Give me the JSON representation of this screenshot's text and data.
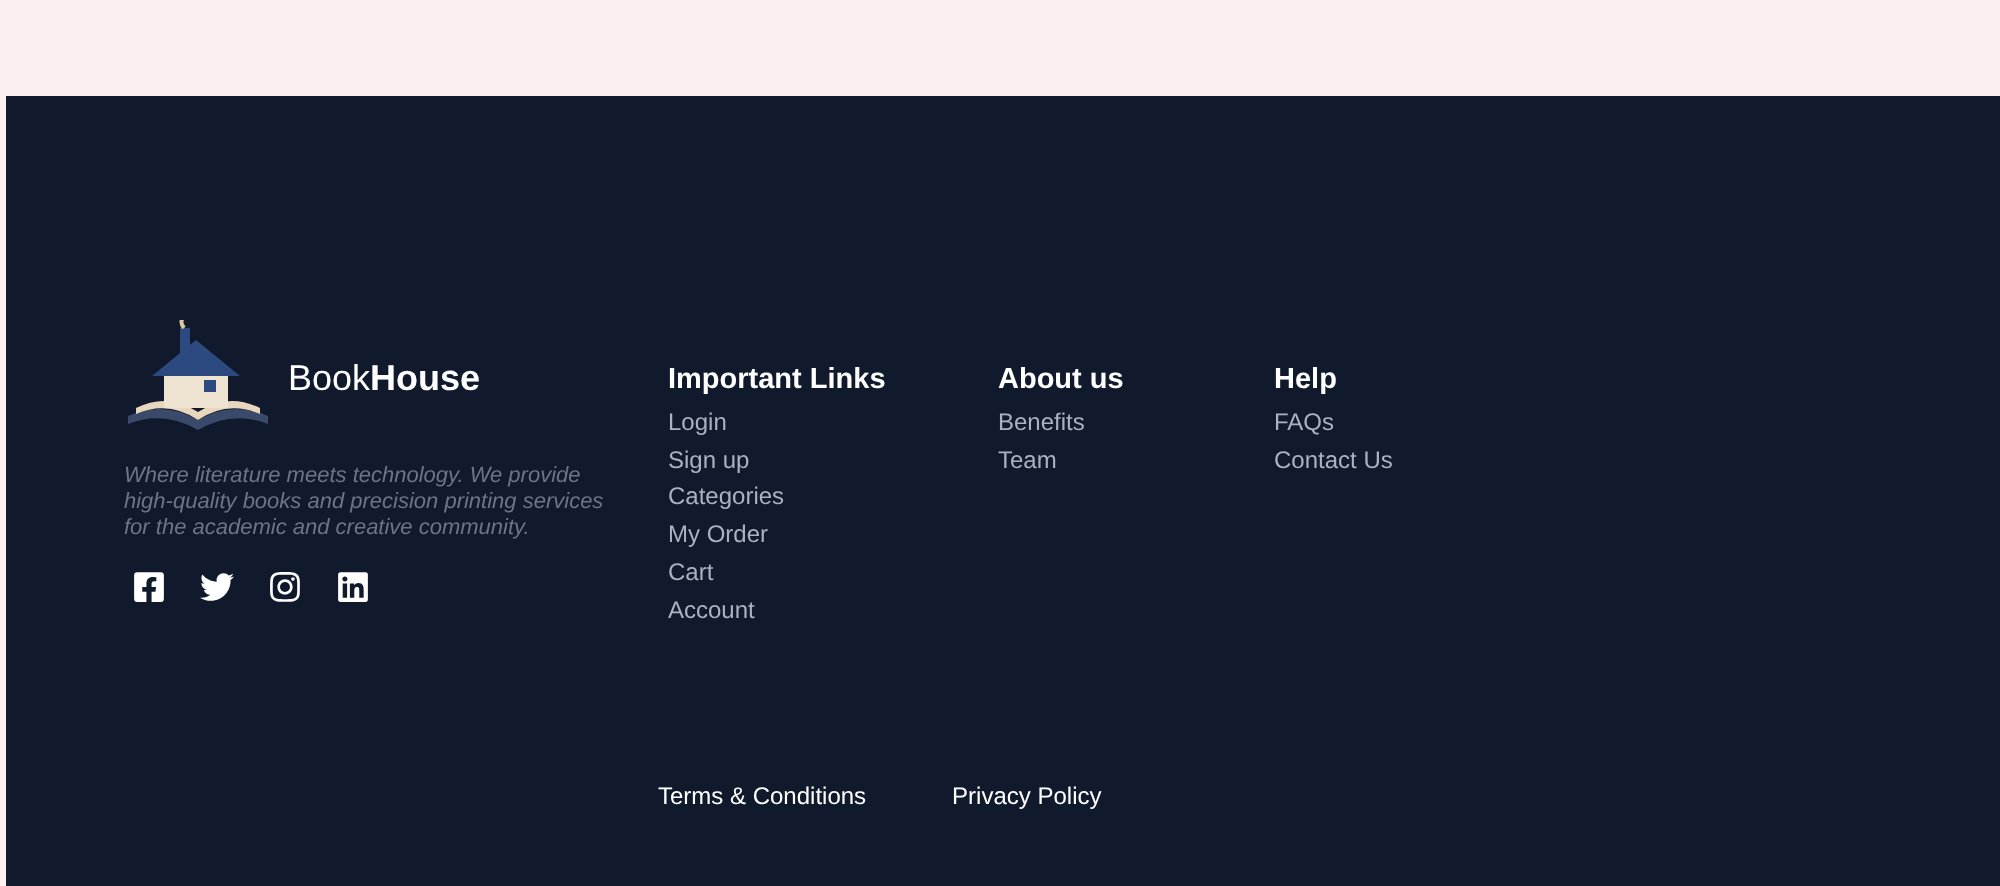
{
  "brand": {
    "name": "Book**House**",
    "tagline": "Where literature meets technology. We provide high-quality books and precision printing services for the academic and creative community."
  },
  "social": [
    {
      "kind": "facebook"
    },
    {
      "kind": "twitter"
    },
    {
      "kind": "instagram"
    },
    {
      "kind": "linkedin"
    }
  ],
  "columns": [
    {
      "title": "Important Links",
      "links": [
        "Login",
        "Sign up",
        "Categories",
        "My Order",
        "Cart",
        "Account"
      ]
    },
    {
      "title": "About us",
      "links": [
        "Benefits",
        "Team"
      ]
    },
    {
      "title": "Help",
      "links": [
        "FAQs",
        "Contact Us"
      ]
    }
  ],
  "bottom_links": [
    "Terms & Conditions",
    "Privacy Policy"
  ]
}
